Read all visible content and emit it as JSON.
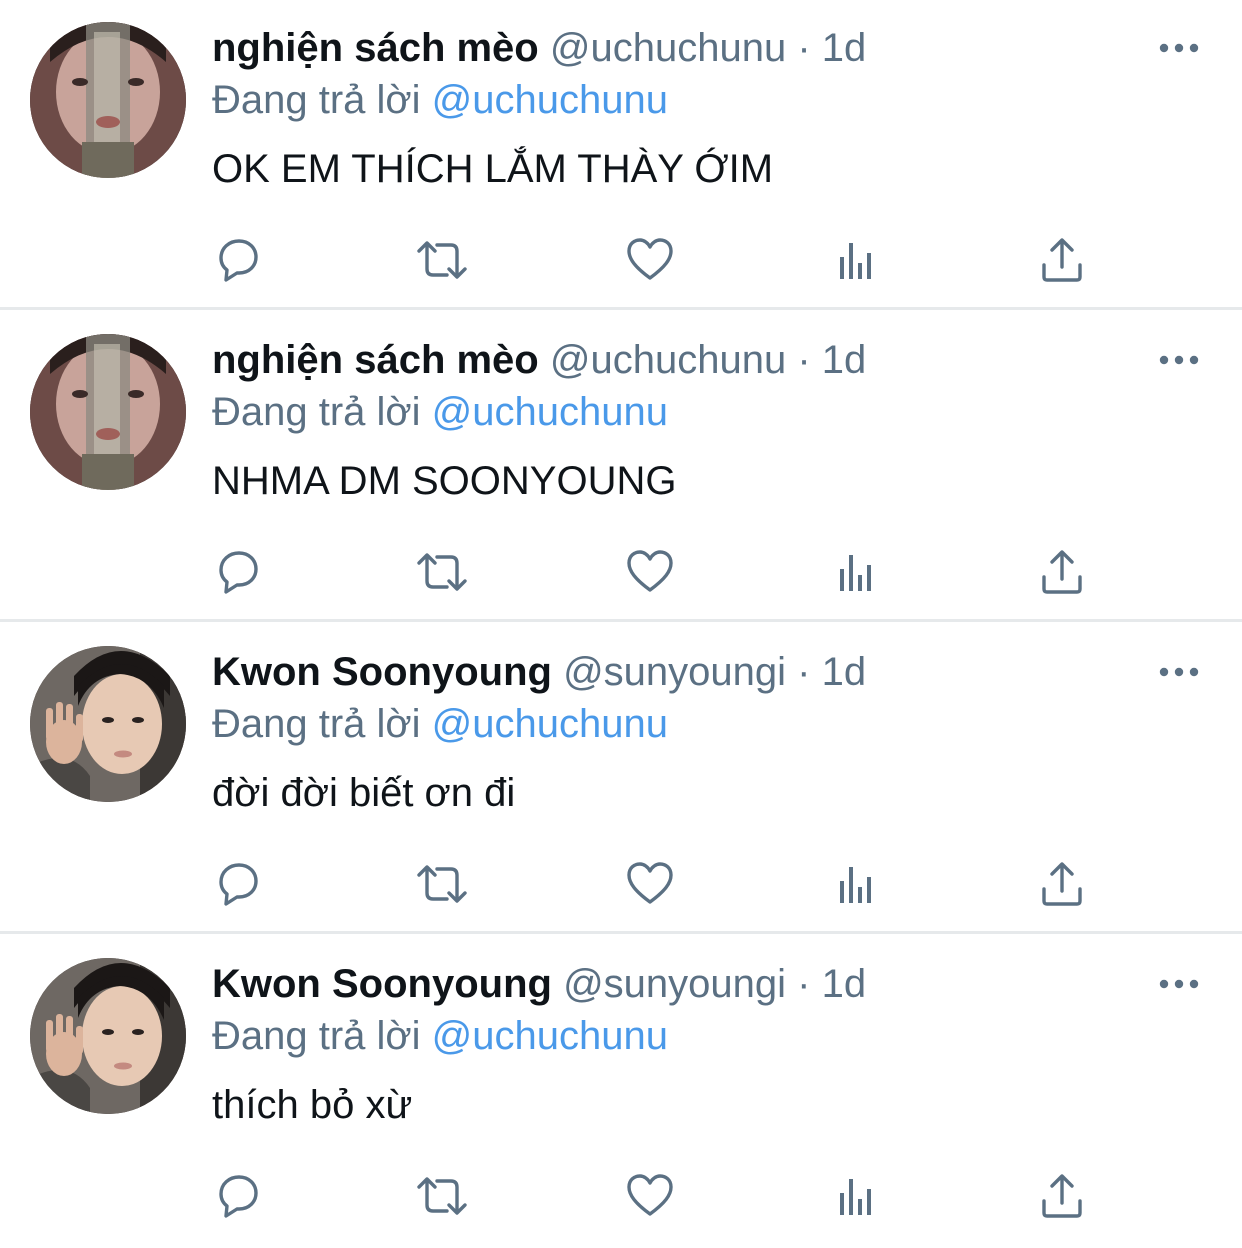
{
  "colors": {
    "text": "#0f1419",
    "secondary": "#5b7083",
    "mention": "#4a99e9",
    "divider": "#e6e9eb"
  },
  "icons": {
    "reply": "reply-icon",
    "retweet": "retweet-icon",
    "like": "heart-icon",
    "analytics": "analytics-icon",
    "share": "share-icon",
    "more": "more-options-icon"
  },
  "tweets": [
    {
      "name": "nghiện sách mèo",
      "handle": "@uchuchunu",
      "separator": "·",
      "time": "1d",
      "replying_prefix": "Đang trả lời",
      "replying_to": "@uchuchunu",
      "text": "OK EM THÍCH LẮM THÀY ỚIM"
    },
    {
      "name": "nghiện sách mèo",
      "handle": "@uchuchunu",
      "separator": "·",
      "time": "1d",
      "replying_prefix": "Đang trả lời",
      "replying_to": "@uchuchunu",
      "text": "NHMA DM SOONYOUNG"
    },
    {
      "name": "Kwon Soonyoung",
      "handle": "@sunyoungi",
      "separator": "·",
      "time": "1d",
      "replying_prefix": "Đang trả lời",
      "replying_to": "@uchuchunu",
      "text": "đời đời biết ơn đi"
    },
    {
      "name": "Kwon Soonyoung",
      "handle": "@sunyoungi",
      "separator": "·",
      "time": "1d",
      "replying_prefix": "Đang trả lời",
      "replying_to": "@uchuchunu",
      "text": "thích bỏ xừ"
    }
  ]
}
